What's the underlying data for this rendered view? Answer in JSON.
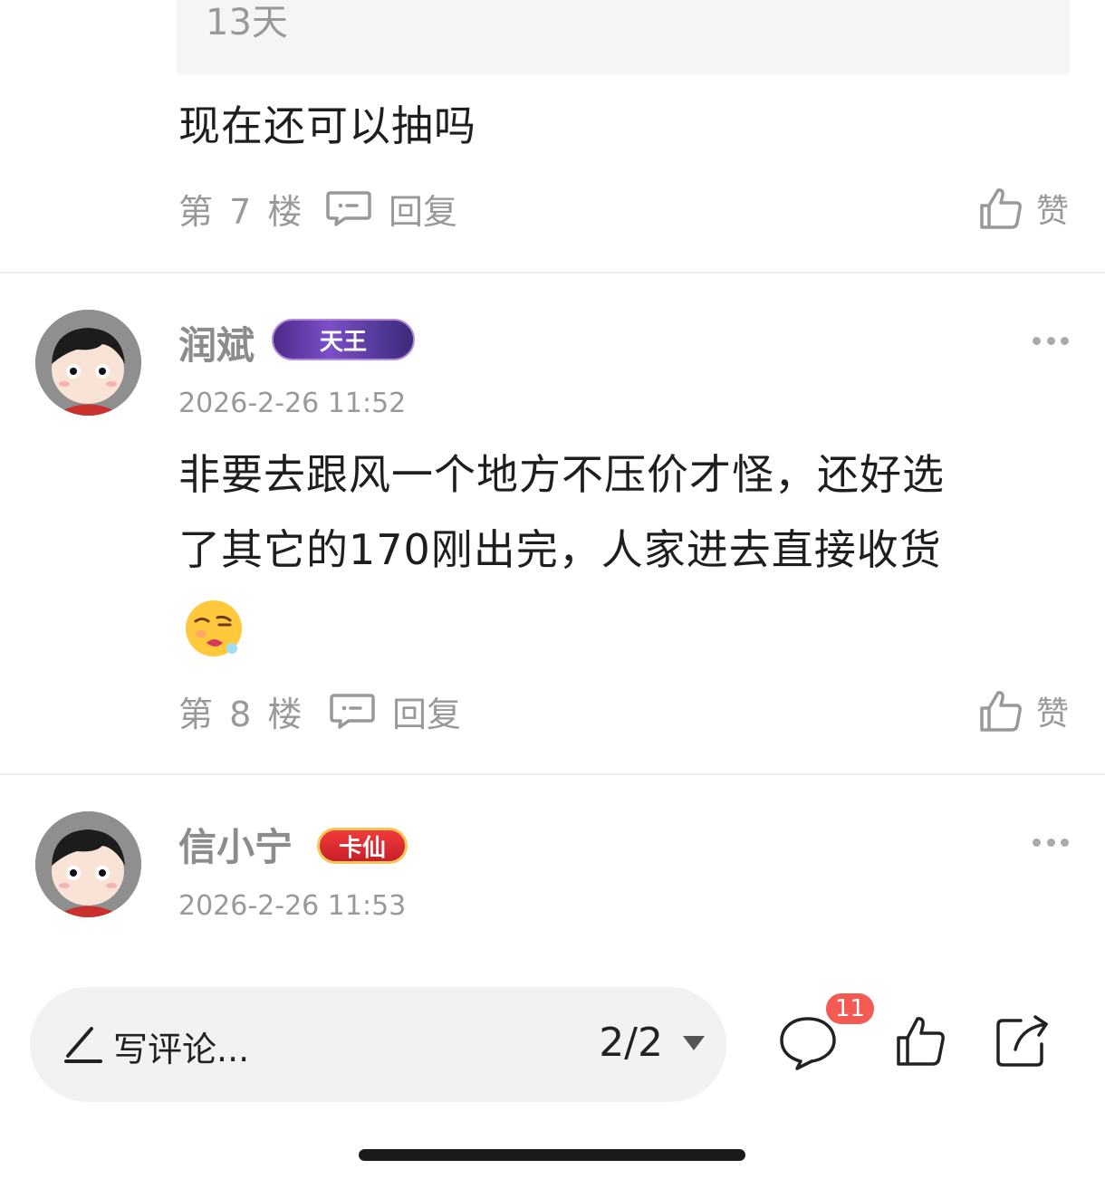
{
  "quoted": {
    "text": "13天"
  },
  "posts": [
    {
      "content": "现在还可以抽吗",
      "floor": "第 7 楼",
      "reply_label": "回复",
      "like_label": "赞"
    },
    {
      "username": "润斌",
      "badge": "天王",
      "timestamp": "2026-2-26 11:52",
      "content_line1": "非要去跟风一个地方不压价才怪，还好选",
      "content_line2": "了其它的170刚出完，人家进去直接收货",
      "emoji_icon": "drooling-face-emoji-icon",
      "floor": "第 8 楼",
      "reply_label": "回复",
      "like_label": "赞"
    },
    {
      "username": "信小宁",
      "badge": "卡仙",
      "timestamp": "2026-2-26 11:53"
    }
  ],
  "bottom_bar": {
    "placeholder": "写评论...",
    "page_indicator": "2/2",
    "comment_count": "11"
  },
  "colors": {
    "badge_red": "#f25a52",
    "muted_text": "#999999",
    "input_bg": "#f2f2f2"
  }
}
